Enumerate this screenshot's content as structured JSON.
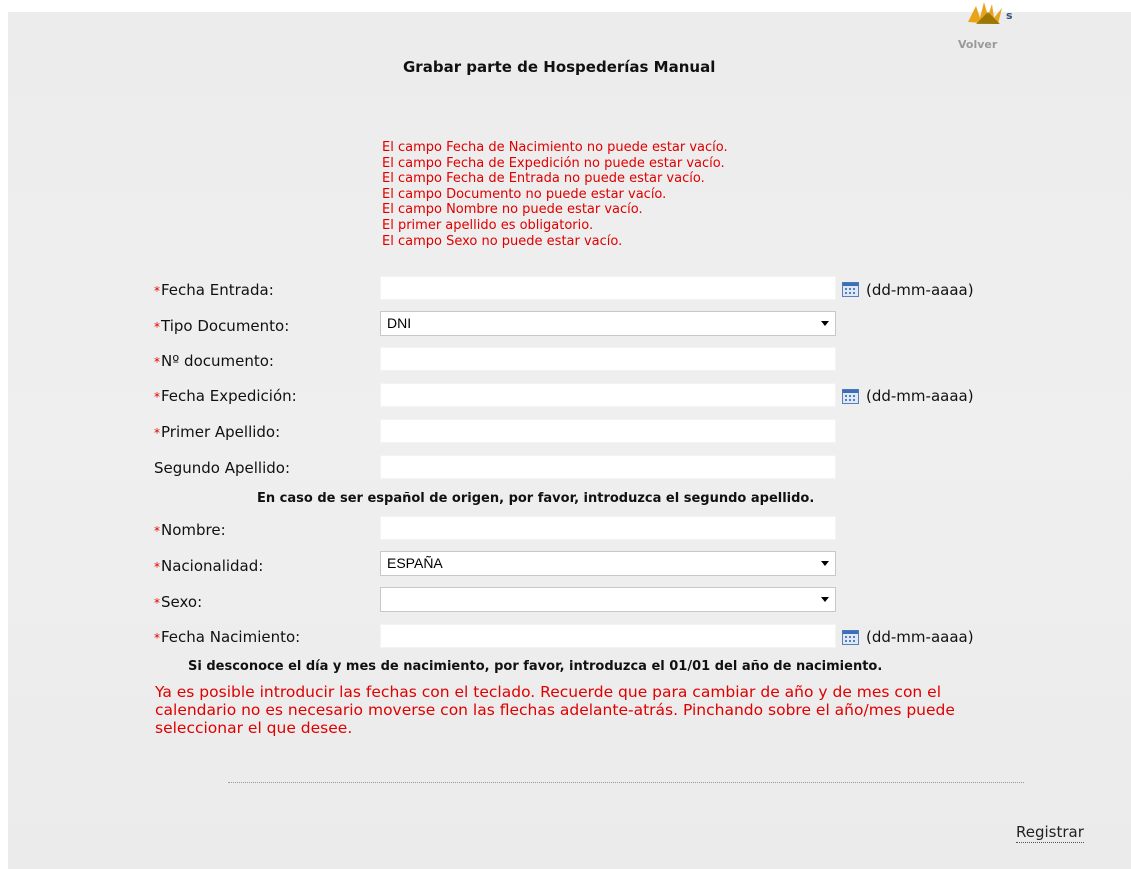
{
  "header": {
    "title": "Grabar parte de Hospederías Manual",
    "back_label": "Volver"
  },
  "errors": [
    "El campo Fecha de Nacimiento no puede estar vacío.",
    "El campo Fecha de Expedición no puede estar vacío.",
    "El campo Fecha de Entrada no puede estar vacío.",
    "El campo Documento no puede estar vacío.",
    "El campo Nombre no puede estar vacío.",
    "El primer apellido es obligatorio.",
    "El campo Sexo no puede estar vacío."
  ],
  "form": {
    "required_mark": "*",
    "date_format": "(dd-mm-aaaa)",
    "fecha_entrada": {
      "label": "Fecha Entrada:",
      "value": ""
    },
    "tipo_documento": {
      "label": "Tipo Documento:",
      "selected": "DNI"
    },
    "numero_documento": {
      "label": "Nº documento:",
      "value": ""
    },
    "fecha_expedicion": {
      "label": "Fecha Expedición:",
      "value": ""
    },
    "primer_apellido": {
      "label": "Primer Apellido:",
      "value": ""
    },
    "segundo_apellido": {
      "label": "Segundo Apellido:",
      "value": ""
    },
    "segundo_apellido_note": "En caso de ser español de origen, por favor, introduzca el segundo apellido.",
    "nombre": {
      "label": "Nombre:",
      "value": ""
    },
    "nacionalidad": {
      "label": "Nacionalidad:",
      "selected": "ESPAÑA"
    },
    "sexo": {
      "label": "Sexo:",
      "selected": ""
    },
    "fecha_nacimiento": {
      "label": "Fecha Nacimiento:",
      "value": ""
    },
    "fecha_nacimiento_note": "Si desconoce el día y mes de nacimiento, por favor, introduzca el 01/01 del año de nacimiento."
  },
  "info_text": "Ya es posible introducir las fechas con el teclado. Recuerde que para cambiar de año y de mes con el calendario no es necesario moverse con las flechas adelante-atrás. Pinchando sobre el año/mes puede seleccionar el que desee.",
  "actions": {
    "register_label": "Registrar"
  },
  "colors": {
    "error": "#e00000",
    "background": "#ededed"
  },
  "icons": [
    "logo-icon",
    "calendar-icon",
    "chevron-down-icon"
  ]
}
